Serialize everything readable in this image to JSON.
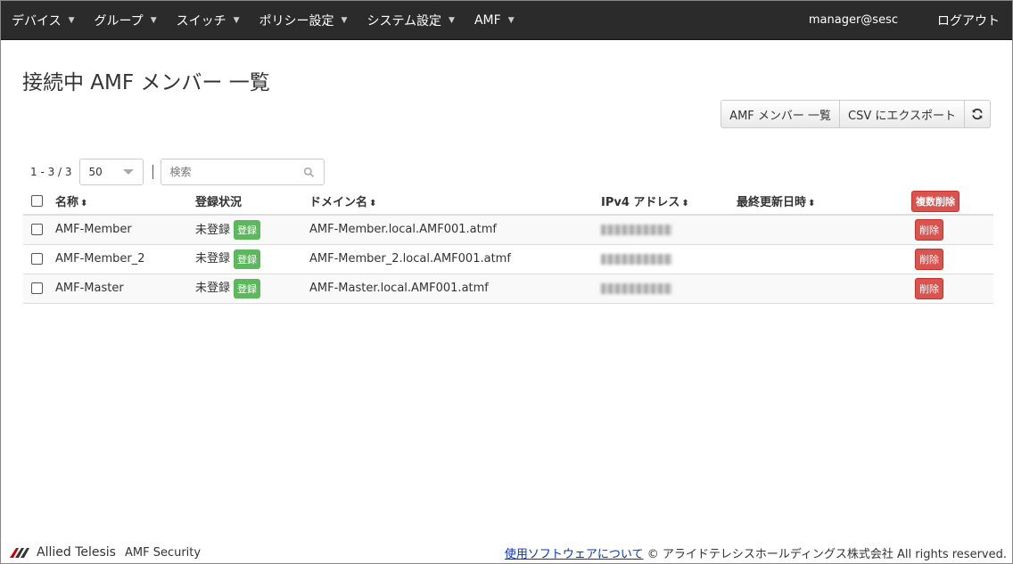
{
  "nav": {
    "items": [
      "デバイス",
      "グループ",
      "スイッチ",
      "ポリシー設定",
      "システム設定",
      "AMF"
    ],
    "user": "manager@sesc",
    "logout": "ログアウト"
  },
  "page": {
    "title": "接続中 AMF メンバー 一覧"
  },
  "actions": {
    "list_btn": "AMF メンバー 一覧",
    "csv_btn": "CSV にエクスポート",
    "refresh_icon": "refresh-icon"
  },
  "toolbar": {
    "count": "1 - 3 / 3",
    "page_size": "50",
    "search_placeholder": "検索"
  },
  "table": {
    "headers": {
      "name": "名称",
      "status": "登録状況",
      "domain": "ドメイン名",
      "ipv4": "IPv4 アドレス",
      "updated": "最終更新日時",
      "bulk_delete": "複数削除"
    },
    "rows": [
      {
        "name": "AMF-Member",
        "status": "未登録",
        "register": "登録",
        "domain": "AMF-Member.local.AMF001.atmf",
        "delete": "削除"
      },
      {
        "name": "AMF-Member_2",
        "status": "未登録",
        "register": "登録",
        "domain": "AMF-Member_2.local.AMF001.atmf",
        "delete": "削除"
      },
      {
        "name": "AMF-Master",
        "status": "未登録",
        "register": "登録",
        "domain": "AMF-Master.local.AMF001.atmf",
        "delete": "削除"
      }
    ]
  },
  "footer": {
    "brand": "Allied Telesis",
    "product": "AMF Security",
    "link": "使用ソフトウェアについて",
    "copyright": "© アライドテレシスホールディングス株式会社 All rights reserved."
  }
}
